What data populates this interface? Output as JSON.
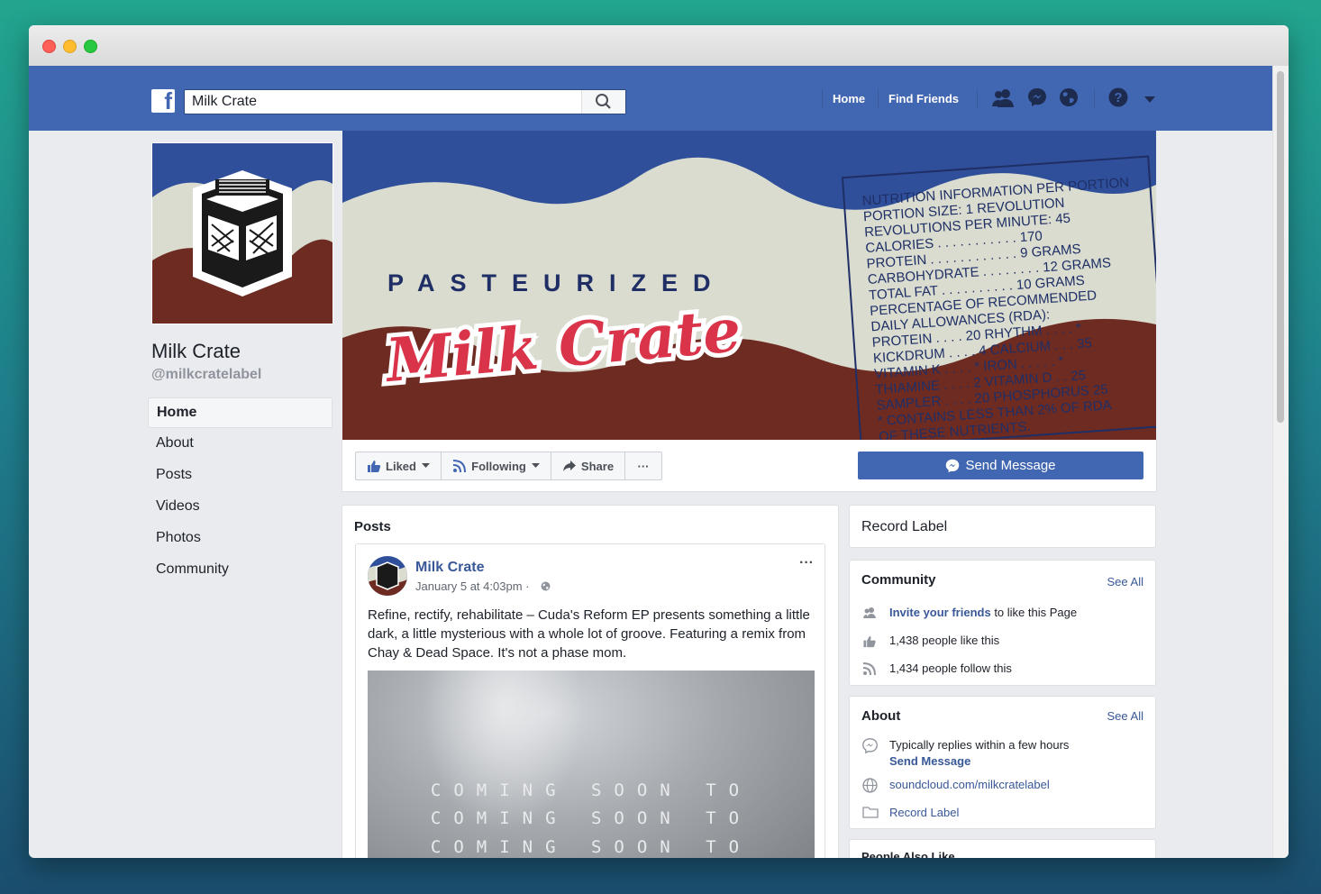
{
  "search": {
    "value": "Milk Crate"
  },
  "topnav": {
    "home": "Home",
    "find_friends": "Find Friends"
  },
  "page": {
    "name": "Milk Crate",
    "handle": "@milkcratelabel"
  },
  "sidebar": {
    "items": [
      {
        "label": "Home",
        "active": true
      },
      {
        "label": "About"
      },
      {
        "label": "Posts"
      },
      {
        "label": "Videos"
      },
      {
        "label": "Photos"
      },
      {
        "label": "Community"
      }
    ]
  },
  "cover": {
    "pasteurized": "PASTEURIZED",
    "brand": "Milk Crate",
    "nutrition": [
      "NUTRITION INFORMATION PER PORTION",
      "PORTION SIZE: 1 REVOLUTION",
      "REVOLUTIONS PER MINUTE: 45",
      "CALORIES . . . . . . . . . . . 170",
      "PROTEIN . . . . . . . . . . . . 9 GRAMS",
      "CARBOHYDRATE . . . . . . . . 12 GRAMS",
      "TOTAL FAT . . . . . . . . . . 10 GRAMS",
      "PERCENTAGE OF RECOMMENDED",
      "DAILY ALLOWANCES (RDA):",
      "PROTEIN . . . . 20   RHYTHM . . . . *",
      "KICKDRUM . . . . 4   CALCIUM . . . 35",
      "VITAMIN K . . . . *   IRON . . . . . *",
      "THIAMINE . . . . 2   VITAMIN D . . 25",
      "SAMPLER . . . . 20   PHOSPHORUS 25",
      "* CONTAINS LESS THAN 2% OF RDA",
      "OF THESE NUTRIENTS."
    ]
  },
  "actions": {
    "liked": "Liked",
    "following": "Following",
    "share": "Share",
    "more": "···",
    "send_message": "Send Message"
  },
  "posts": {
    "header": "Posts",
    "post": {
      "author": "Milk Crate",
      "time": "January 5 at 4:03pm ·",
      "menu": "···",
      "text": "Refine, rectify, rehabilitate – Cuda's Reform EP presents something a little dark, a little mysterious with a whole lot of groove. Featuring a remix from Chay & Dead Space. It's not a phase mom.",
      "image_lines": [
        "COMING SOON TO",
        "COMING SOON TO",
        "COMING SOON TO"
      ]
    }
  },
  "right": {
    "category": "Record Label",
    "community": {
      "title": "Community",
      "see_all": "See All",
      "invite_link": "Invite your friends",
      "invite_rest": " to like this Page",
      "likes": "1,438 people like this",
      "follows": "1,434 people follow this"
    },
    "about": {
      "title": "About",
      "see_all": "See All",
      "replies": "Typically replies within a few hours",
      "send_message": "Send Message",
      "website": "soundcloud.com/milkcratelabel",
      "category": "Record Label"
    },
    "people_also_like": "People Also Like"
  },
  "colors": {
    "fb_blue": "#4267b2",
    "link": "#385898",
    "cover_blue": "#2f4f9a",
    "cover_cream": "#d9dccf",
    "cover_brown": "#6e2b22",
    "brand_red": "#d9344a"
  }
}
